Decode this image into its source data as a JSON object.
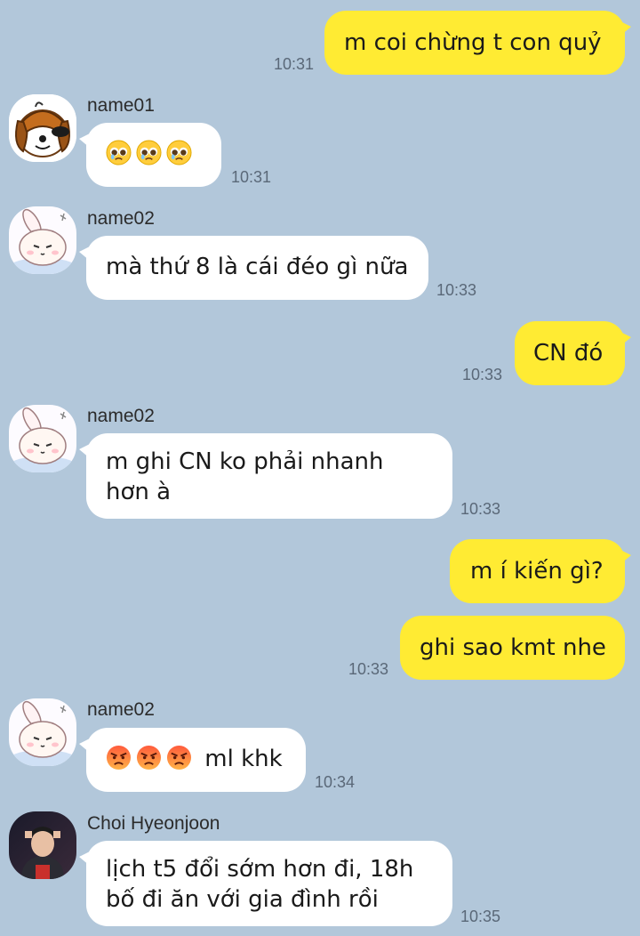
{
  "chat": {
    "messages": [
      {
        "id": "m1",
        "side": "out",
        "text": "m coi chừng t con quỷ",
        "time": "10:31"
      },
      {
        "id": "m2",
        "side": "in",
        "sender": "name01",
        "emoji": [
          "pleading-face",
          "pleading-face",
          "pleading-face"
        ],
        "text": "",
        "time": "10:31"
      },
      {
        "id": "m3",
        "side": "in",
        "sender": "name02",
        "text": "mà thứ 8 là cái đéo gì nữa",
        "time": "10:33"
      },
      {
        "id": "m4",
        "side": "out",
        "text": "CN đó",
        "time": "10:33"
      },
      {
        "id": "m5",
        "side": "in",
        "sender": "name02",
        "lines": [
          "m ghi CN ko phải nhanh",
          "hơn à"
        ],
        "time": "10:33"
      },
      {
        "id": "m6",
        "side": "out",
        "text": "m í kiến gì?",
        "time": ""
      },
      {
        "id": "m7",
        "side": "out",
        "text": "ghi sao kmt nhe",
        "time": "10:33"
      },
      {
        "id": "m8",
        "side": "in",
        "sender": "name02",
        "emoji": [
          "angry-face",
          "angry-face",
          "angry-face"
        ],
        "text": "ml khk",
        "time": "10:34"
      },
      {
        "id": "m9",
        "side": "in",
        "sender": "Choi Hyeonjoon",
        "lines": [
          "lịch t5 đổi sớm hơn đi, 18h",
          "bố đi ăn với gia đình rồi"
        ],
        "time": "10:35"
      }
    ]
  },
  "colors": {
    "background": "#b2c7da",
    "outgoing_bubble": "#ffeb33",
    "incoming_bubble": "#ffffff",
    "timestamp": "#5a6878"
  },
  "avatars": {
    "name01": "dog-avatar-icon",
    "name02": "bunny-avatar-icon",
    "choi": "person-avatar-icon"
  }
}
